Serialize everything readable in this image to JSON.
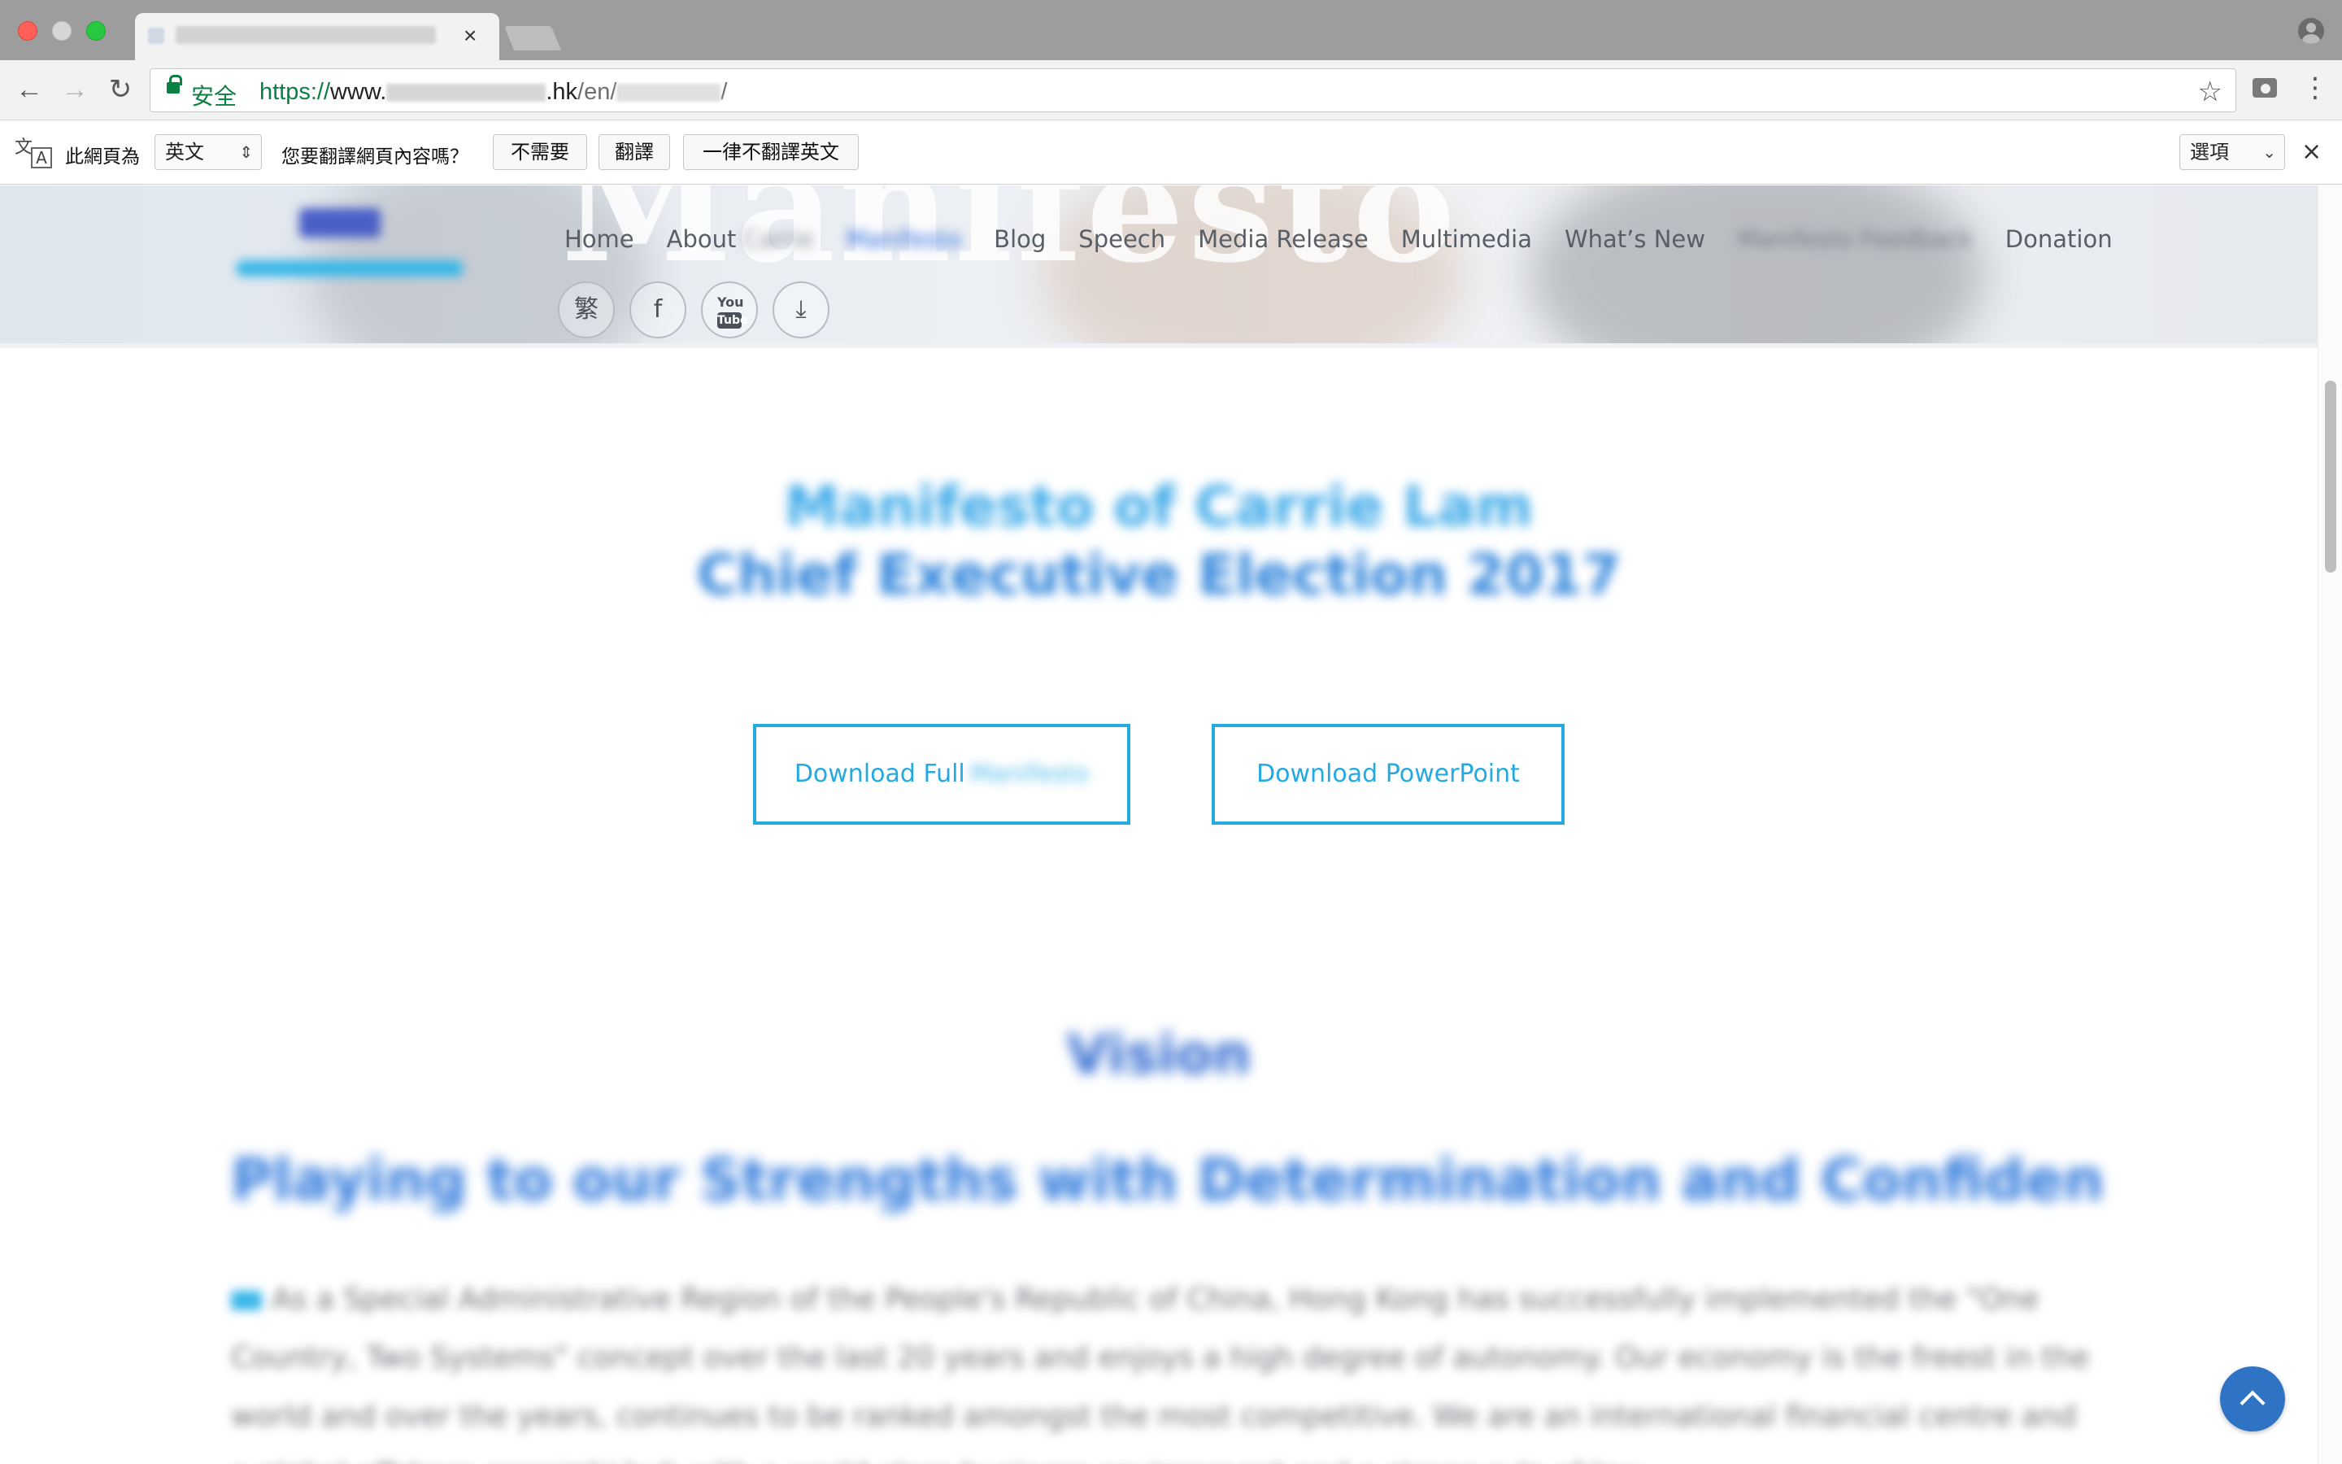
{
  "browser": {
    "tab_close": "×",
    "secure_label": "安全",
    "url": {
      "scheme": "https://",
      "host_prefix": "www.",
      "host_suffix": ".hk",
      "path": "/en/",
      "trailing": "/"
    }
  },
  "translate_bar": {
    "page_language_label": "此網頁為",
    "language_value": "英文",
    "question": "您要翻譯網頁內容嗎？",
    "no_button": "不需要",
    "translate_button": "翻譯",
    "never_button": "一律不翻譯英文",
    "options_label": "選項",
    "close": "×"
  },
  "site": {
    "hero_watermark": "Manifesto",
    "nav": {
      "home": "Home",
      "about": "About",
      "about_extra": "Carrie",
      "manifesto": "Manifesto",
      "blog": "Blog",
      "speech": "Speech",
      "media_release": "Media Release",
      "multimedia": "Multimedia",
      "whats_new": "What’s New",
      "feedback": "Manifesto Feedback",
      "donation": "Donation"
    },
    "social": {
      "lang_toggle": "繁",
      "facebook": "f",
      "youtube_top": "You",
      "youtube_bottom": "Tube",
      "download": "⤓"
    },
    "headline_line1": "Manifesto of Carrie Lam",
    "headline_line2": "Chief Executive Election 2017",
    "download_full_label": "Download Full",
    "download_full_blurred": "Manifesto",
    "download_ppt_label": "Download PowerPoint",
    "vision_heading": "Vision",
    "strengths_heading": "Playing to our Strengths with Determination and Confidence",
    "body_text": "As a Special Administrative Region of the People's Republic of China, Hong Kong has successfully implemented the \"One Country, Two Systems\" concept over the last 20 years and enjoys a high degree of autonomy. Our economy is the freest in the world and over the years, continues to be ranked amongst the most competitive. We are an international financial centre and a global offshore renminbi hub with a world-class business environment and a strong rule of law."
  },
  "colors": {
    "accent": "#24a9e1",
    "nav_text": "#585e66",
    "back_to_top": "#2f73c4"
  }
}
